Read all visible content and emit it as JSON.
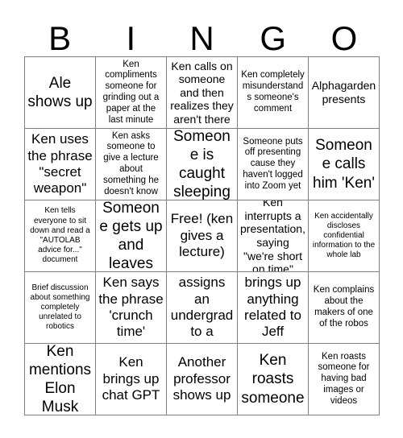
{
  "card": {
    "title": "BINGO",
    "header_letters": [
      "B",
      "I",
      "N",
      "G",
      "O"
    ],
    "grid_size": "5x5",
    "colors": {
      "text": "#000000",
      "background": "#ffffff",
      "grid_line": "#808080"
    },
    "rows": [
      [
        {
          "text": "Ale shows up",
          "size": "xl"
        },
        {
          "text": "Ken compliments someone for grinding out a paper at the last minute",
          "size": "sm"
        },
        {
          "text": "Ken calls on someone and then realizes they aren't there",
          "size": "md"
        },
        {
          "text": "Ken completely misunderstands someone's comment",
          "size": "sm"
        },
        {
          "text": "Alphagarden presents",
          "size": "md"
        }
      ],
      [
        {
          "text": "Ken uses the phrase \"secret weapon\"",
          "size": "lg"
        },
        {
          "text": "Ken asks someone to give a lecture about something he doesn't know",
          "size": "sm"
        },
        {
          "text": "Someone is caught sleeping",
          "size": "xl"
        },
        {
          "text": "Someone puts off presenting cause they haven't logged into Zoom yet",
          "size": "sm"
        },
        {
          "text": "Someone calls him 'Ken'",
          "size": "xl"
        }
      ],
      [
        {
          "text": "Ken tells everyone to sit down and read a \"AUTOLAB advice for...\" document",
          "size": "xs"
        },
        {
          "text": "Someone gets up and leaves",
          "size": "xl"
        },
        {
          "text": "Free! (ken gives a lecture)",
          "size": "lg"
        },
        {
          "text": "Ken interrupts a presentation, saying \"we're short on time\"",
          "size": "md"
        },
        {
          "text": "Ken accidentally discloses confidential information to the whole lab",
          "size": "xs"
        }
      ],
      [
        {
          "text": "Brief discussion about something completely unrelated to robotics",
          "size": "xs"
        },
        {
          "text": "Ken says the phrase 'crunch time'",
          "size": "lg"
        },
        {
          "text": "Ken assigns an undergrad to a project",
          "size": "lg"
        },
        {
          "text": "Ken brings up anything related to Jeff Mahler",
          "size": "lg"
        },
        {
          "text": "Ken complains about the makers of one of the robos",
          "size": "sm"
        }
      ],
      [
        {
          "text": "Ken mentions Elon Musk",
          "size": "xl"
        },
        {
          "text": "Ken brings up chat GPT",
          "size": "lg"
        },
        {
          "text": "Another professor shows up",
          "size": "lg"
        },
        {
          "text": "Ken roasts someone",
          "size": "xl"
        },
        {
          "text": "Ken roasts someone for having bad images or videos",
          "size": "sm"
        }
      ]
    ]
  }
}
